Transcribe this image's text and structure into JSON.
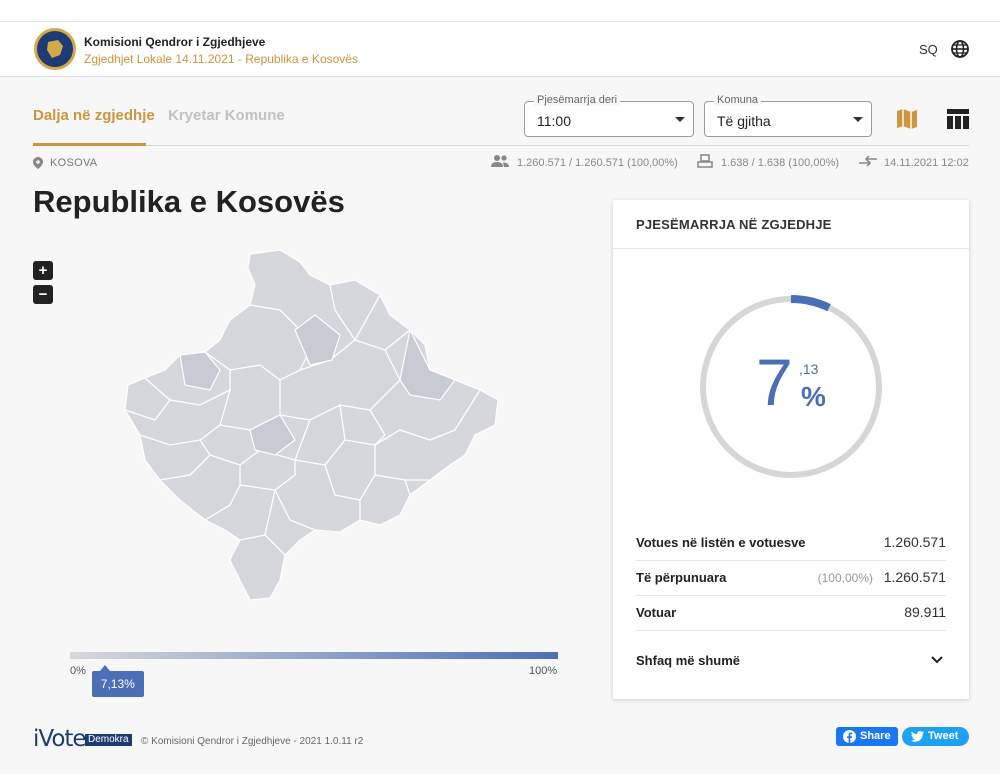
{
  "header": {
    "org_name": "Komisioni Qendror i Zgjedhjeve",
    "subtitle": "Zgjedhjet Lokale 14.11.2021 - Republika e Kosovës",
    "language": "SQ",
    "icons": {
      "logo": "kqz-logo",
      "globe": "globe-icon"
    }
  },
  "tabs": [
    {
      "label": "Dalja në zgjedhje",
      "active": true
    },
    {
      "label": "Kryetar Komune",
      "active": false
    }
  ],
  "filters": {
    "turnout_time": {
      "label": "Pjesëmarrja deri",
      "value": "11:00"
    },
    "municipality": {
      "label": "Komuna",
      "value": "Të gjitha"
    }
  },
  "breadcrumb": "KOSOVA",
  "stats": {
    "voters": "1.260.571 / 1.260.571 (100,00%)",
    "polling_stations": "1.638 / 1.638 (100,00%)",
    "updated": "14.11.2021 12:02"
  },
  "page_title": "Republika e Kosovës",
  "zoom": {
    "in": "+",
    "out": "−"
  },
  "scale": {
    "min": "0%",
    "max": "100%",
    "current": "7,13%",
    "current_fraction": 0.0713
  },
  "turnout_card": {
    "title": "PJESËMARRJA NË ZGJEDHJE",
    "percent_fraction": 0.0713,
    "integer": "7",
    "decimal": ",13",
    "percent_sign": "%",
    "rows": [
      {
        "label": "Votues në listën e votuesve",
        "pct": "",
        "value": "1.260.571"
      },
      {
        "label": "Të përpunuara",
        "pct": "(100,00%)",
        "value": "1.260.571"
      },
      {
        "label": "Votuar",
        "pct": "",
        "value": "89.911"
      }
    ],
    "show_more": "Shfaq më shumë"
  },
  "footer": {
    "brand": "iVote",
    "badge": "Demokra",
    "copyright": "© Komisioni Qendror i Zgjedhjeve - 2021 1.0.11 r2",
    "share_label": "Share",
    "tweet_label": "Tweet"
  },
  "colors": {
    "accent": "#c9973d",
    "primary": "#4b6fb5",
    "navy": "#1f3b73"
  }
}
